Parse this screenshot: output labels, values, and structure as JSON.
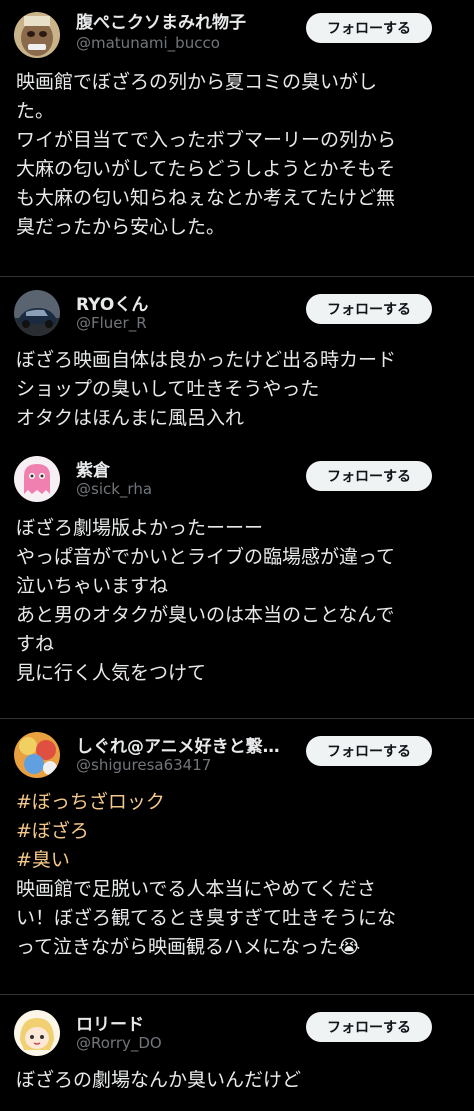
{
  "colors": {
    "background": "#000000",
    "text": "#e7e9ea",
    "secondary": "#71767b",
    "hashtag": "#f4c88a",
    "follow_bg": "#eff3f4",
    "separator": "#2f3336"
  },
  "follow_label": "フォローする",
  "posts": [
    {
      "name": "腹ぺこクソまみれ物子",
      "handle": "@matunami_bucco",
      "avatar_icon": "face-avatar",
      "lines": [
        "映画館でぼざろの列から夏コミの臭いがし",
        "た。",
        "ワイが目当てで入ったボブマーリーの列から",
        "大麻の匂いがしてたらどうしようとかそもそ",
        "も大麻の匂い知らねぇなとか考えてたけど無",
        "臭だったから安心した。"
      ]
    },
    {
      "name": "RYOくん",
      "handle": "@Fluer_R",
      "avatar_icon": "car-avatar",
      "lines": [
        "ぼざろ映画自体は良かったけど出る時カード",
        "ショップの臭いして吐きそうやった",
        "オタクはほんまに風呂入れ"
      ]
    },
    {
      "name": "紫倉",
      "handle": "@sick_rha",
      "avatar_icon": "ghost-avatar",
      "lines": [
        "ぼざろ劇場版よかったーーー",
        "やっぱ音がでかいとライブの臨場感が違って",
        "泣いちゃいますね",
        "あと男のオタクが臭いのは本当のことなんで",
        "すね",
        "見に行く人気をつけて"
      ]
    },
    {
      "name": "しぐれ@アニメ好きと繋…",
      "handle": "@shiguresa63417",
      "avatar_icon": "colorful-avatar",
      "hashtags": [
        "#ぼっちざロック",
        "#ぼざろ",
        "#臭い"
      ],
      "lines": [
        "映画館で足脱いでる人本当にやめてくださ",
        "い！ぼざろ観てるとき臭すぎて吐きそうにな",
        "って泣きながら映画観るハメになった😭"
      ]
    },
    {
      "name": "ロリード",
      "handle": "@Rorry_DO",
      "avatar_icon": "anime-girl-avatar",
      "lines": [
        "ぼざろの劇場なんか臭いんだけど"
      ]
    }
  ]
}
